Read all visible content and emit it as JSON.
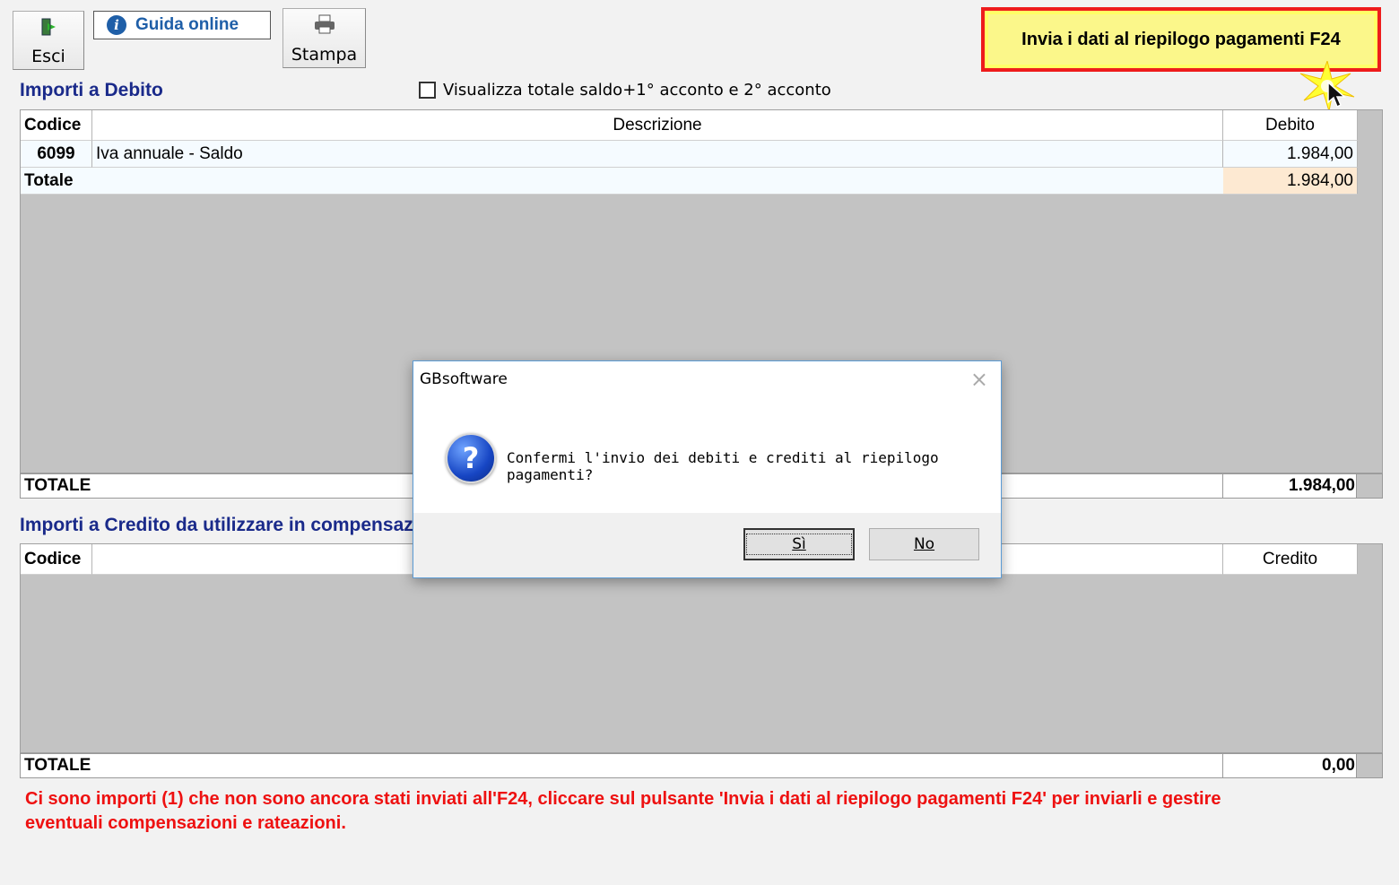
{
  "toolbar": {
    "esci_label": "Esci",
    "guida_label": "Guida online",
    "stampa_label": "Stampa",
    "invia_label": "Invia i dati al riepilogo pagamenti F24"
  },
  "debito": {
    "title": "Importi a Debito",
    "checkbox_label": "Visualizza totale saldo+1° acconto e 2° acconto",
    "headers": {
      "codice": "Codice",
      "descrizione": "Descrizione",
      "debito": "Debito"
    },
    "rows": [
      {
        "codice": "6099",
        "descrizione": "Iva annuale - Saldo",
        "debito": "1.984,00"
      }
    ],
    "subtotal_label": "Totale",
    "subtotal_value": "1.984,00",
    "total_label": "TOTALE",
    "total_value": "1.984,00"
  },
  "credito": {
    "title": "Importi a Credito da utilizzare in compensazione",
    "headers": {
      "codice": "Codice",
      "credito": "Credito"
    },
    "total_label": "TOTALE",
    "total_value": "0,00"
  },
  "warning": {
    "line1": "Ci sono importi (1) che non sono ancora stati inviati all'F24, cliccare sul pulsante 'Invia i dati al riepilogo pagamenti F24' per inviarli e gestire",
    "line2": "eventuali compensazioni e rateazioni."
  },
  "dialog": {
    "title": "GBsoftware",
    "message": "Confermi l'invio dei debiti e crediti al riepilogo pagamenti?",
    "yes_label": "Sì",
    "no_label": "No"
  }
}
